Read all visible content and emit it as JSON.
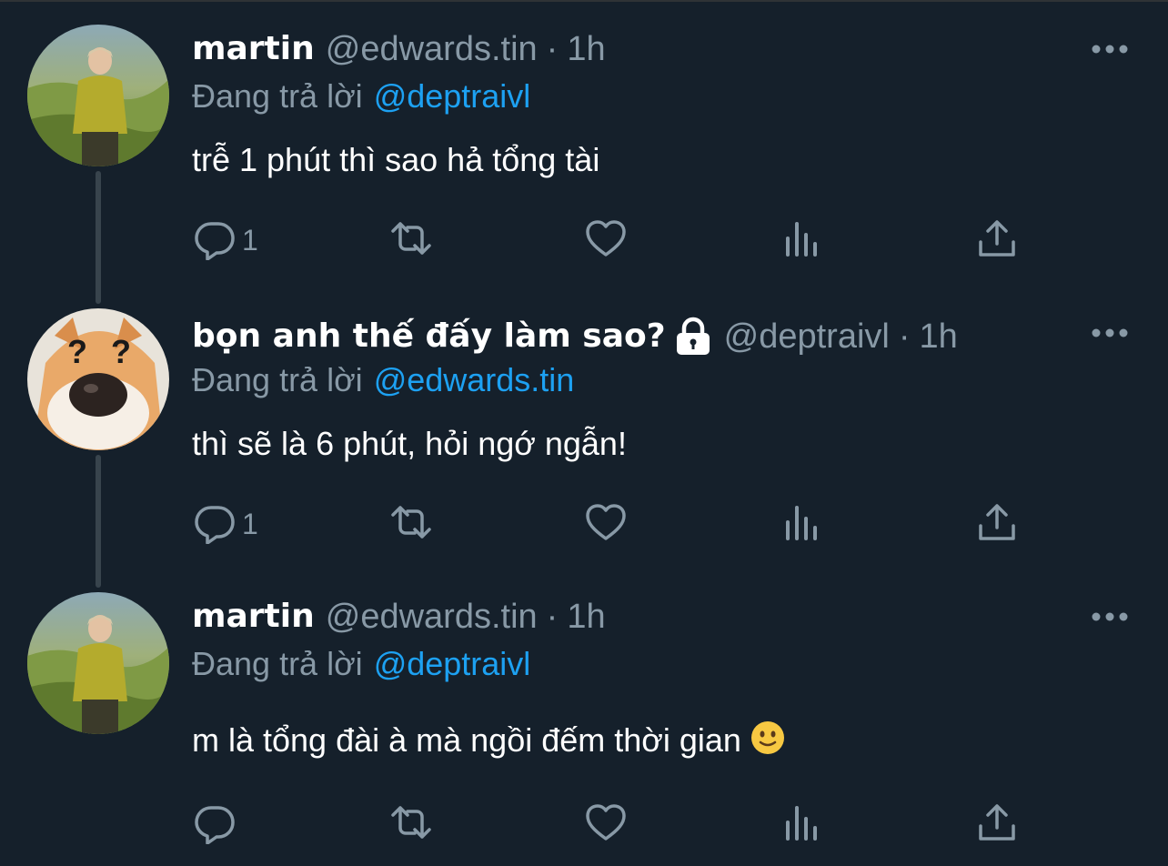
{
  "tweets": [
    {
      "name": "martin",
      "handle": "@edwards.tin",
      "separator": "·",
      "time": "1h",
      "replying_label": "Đang trả lời",
      "replying_to": "@deptraivl",
      "text": "trễ 1 phút thì sao hả tổng tài",
      "reply_count": "1",
      "locked": false,
      "avatar": "avatar-man-yellow-jacket",
      "emoji": ""
    },
    {
      "name": "bọn anh thế đấy làm sao?",
      "handle": "@deptraivl",
      "separator": "·",
      "time": "1h",
      "replying_label": "Đang trả lời",
      "replying_to": "@edwards.tin",
      "text": "thì sẽ là 6 phút, hỏi ngớ ngẫn!",
      "reply_count": "1",
      "locked": true,
      "avatar": "avatar-shiba-question-marks",
      "emoji": ""
    },
    {
      "name": "martin",
      "handle": "@edwards.tin",
      "separator": "·",
      "time": "1h",
      "replying_label": "Đang trả lời",
      "replying_to": "@deptraivl",
      "text": "m là tổng đài à mà ngồi đếm thời gian",
      "reply_count": "",
      "locked": false,
      "avatar": "avatar-man-yellow-jacket",
      "emoji": "slightly-smiling-face-emoji"
    }
  ],
  "colors": {
    "background": "#15202b",
    "name": "#ffffff",
    "secondary": "#8899a6",
    "mention": "#1da1f2",
    "thread_line": "#38444d"
  },
  "icons": [
    "reply-icon",
    "retweet-icon",
    "like-icon",
    "analytics-icon",
    "share-icon",
    "more-icon",
    "lock-icon"
  ]
}
